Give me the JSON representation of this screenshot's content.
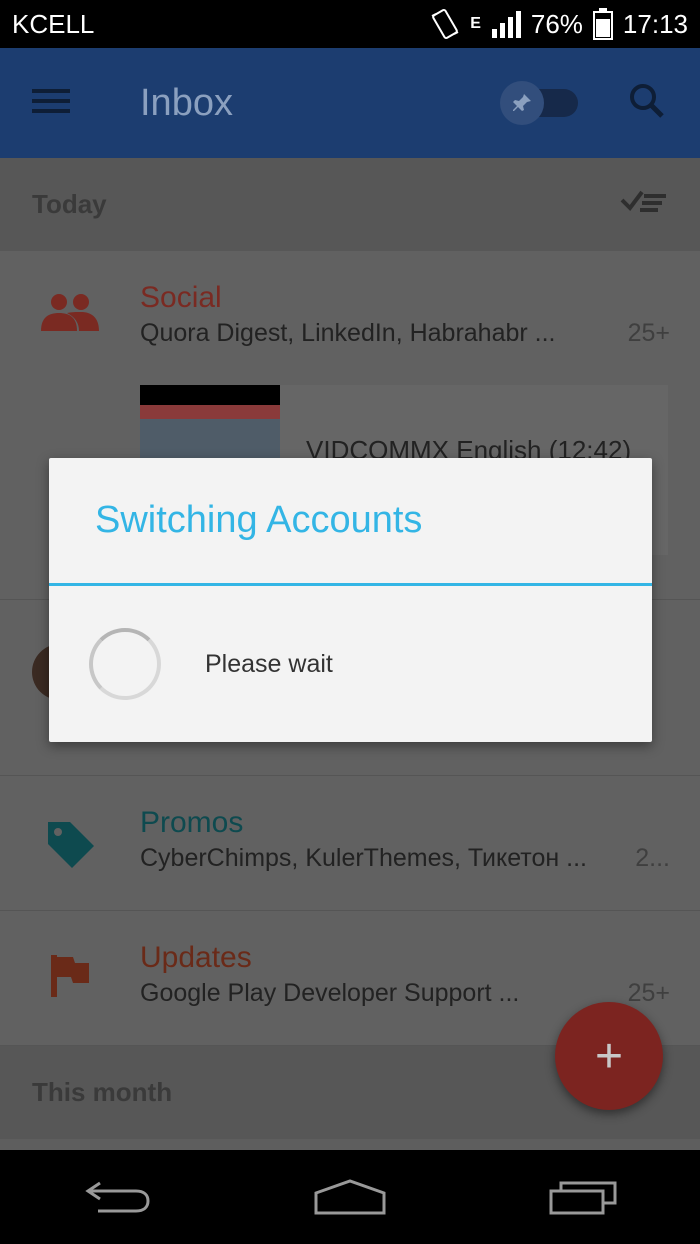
{
  "status_bar": {
    "carrier": "KCELL",
    "network": "E",
    "battery": "76%",
    "time": "17:13"
  },
  "app_bar": {
    "title": "Inbox"
  },
  "sections": {
    "today": "Today",
    "this_month": "This month"
  },
  "bundles": [
    {
      "name": "Social",
      "senders": "Quora Digest, LinkedIn, Habrahabr ...",
      "count": "25+",
      "color": "#b83d30"
    },
    {
      "name": "Promos",
      "senders": "CyberChimps, KulerThemes, Тикетон ...",
      "count": "2...",
      "color": "#1e8c94"
    },
    {
      "name": "Updates",
      "senders": "Google Play Developer Support ...",
      "count": "25+",
      "color": "#c4492a"
    }
  ],
  "preview": {
    "title": "VIDCOMMX English (12:42)"
  },
  "dialog": {
    "title": "Switching Accounts",
    "message": "Please wait"
  },
  "fab": {
    "label": "+"
  }
}
